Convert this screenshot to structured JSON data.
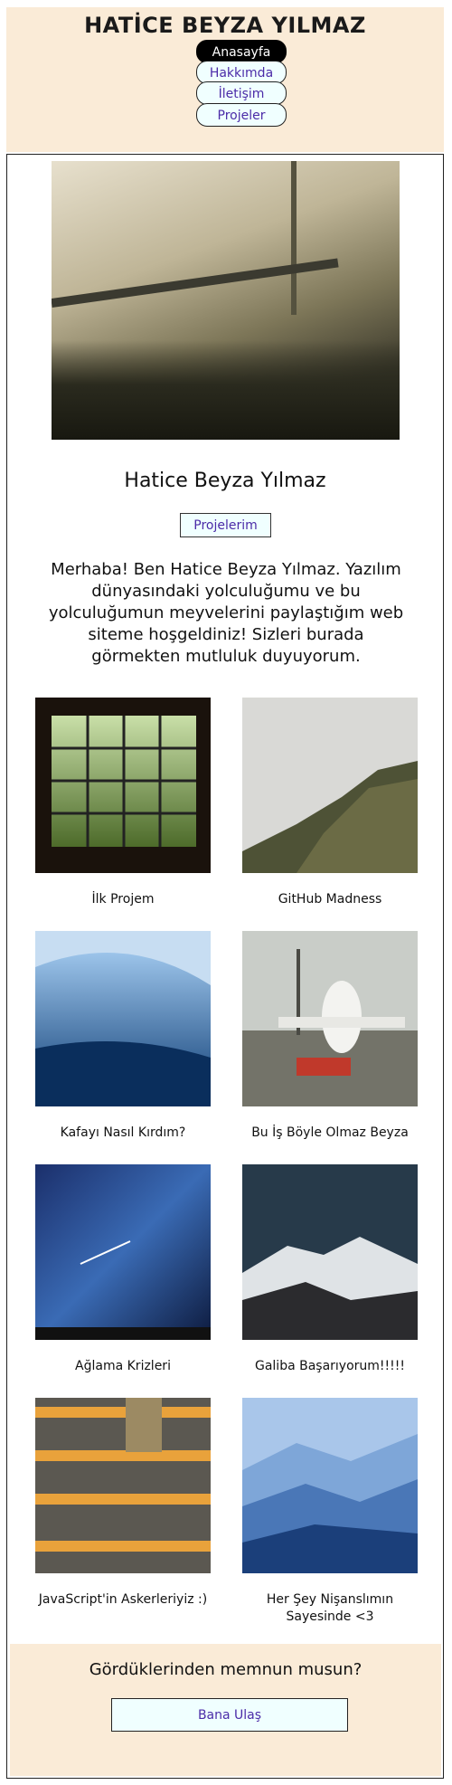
{
  "header": {
    "title": "HATİCE BEYZA YILMAZ",
    "nav": [
      {
        "label": "Anasayfa",
        "active": true
      },
      {
        "label": "Hakkımda",
        "active": false
      },
      {
        "label": "İletişim",
        "active": false
      },
      {
        "label": "Projeler",
        "active": false
      }
    ]
  },
  "hero": {
    "name": "Hatice Beyza Yılmaz",
    "projects_button": "Projelerim",
    "intro": "Merhaba! Ben Hatice Beyza Yılmaz. Yazılım dünyasındaki yolculuğumu ve bu yolculuğumun meyvelerini paylaştığım web siteme hoşgeldiniz! Sizleri burada görmekten mutluluk duyuyorum."
  },
  "projects": [
    {
      "caption": "İlk Projem",
      "image": "forest-window-image"
    },
    {
      "caption": "GitHub Madness",
      "image": "misty-mountain-image"
    },
    {
      "caption": "Kafayı Nasıl Kırdım?",
      "image": "ocean-wave-image"
    },
    {
      "caption": "Bu İş Böyle Olmaz Beyza",
      "image": "airplane-image"
    },
    {
      "caption": "Ağlama Krizleri",
      "image": "night-sky-image"
    },
    {
      "caption": "Galiba Başarıyorum!!!!!",
      "image": "snowy-mountain-image"
    },
    {
      "caption": "JavaScript'in Askerleriyiz :)",
      "image": "stairs-image"
    },
    {
      "caption": "Her Şey Nişanslımın Sayesinde <3",
      "image": "blue-mountains-image"
    }
  ],
  "footer": {
    "question": "Gördüklerinden memnun musun?",
    "contact_button": "Bana Ulaş"
  },
  "colors": {
    "header_bg": "#faebd7",
    "button_bg": "#f0ffff",
    "link_color": "#4b2ba8",
    "active_nav": "#000000"
  }
}
